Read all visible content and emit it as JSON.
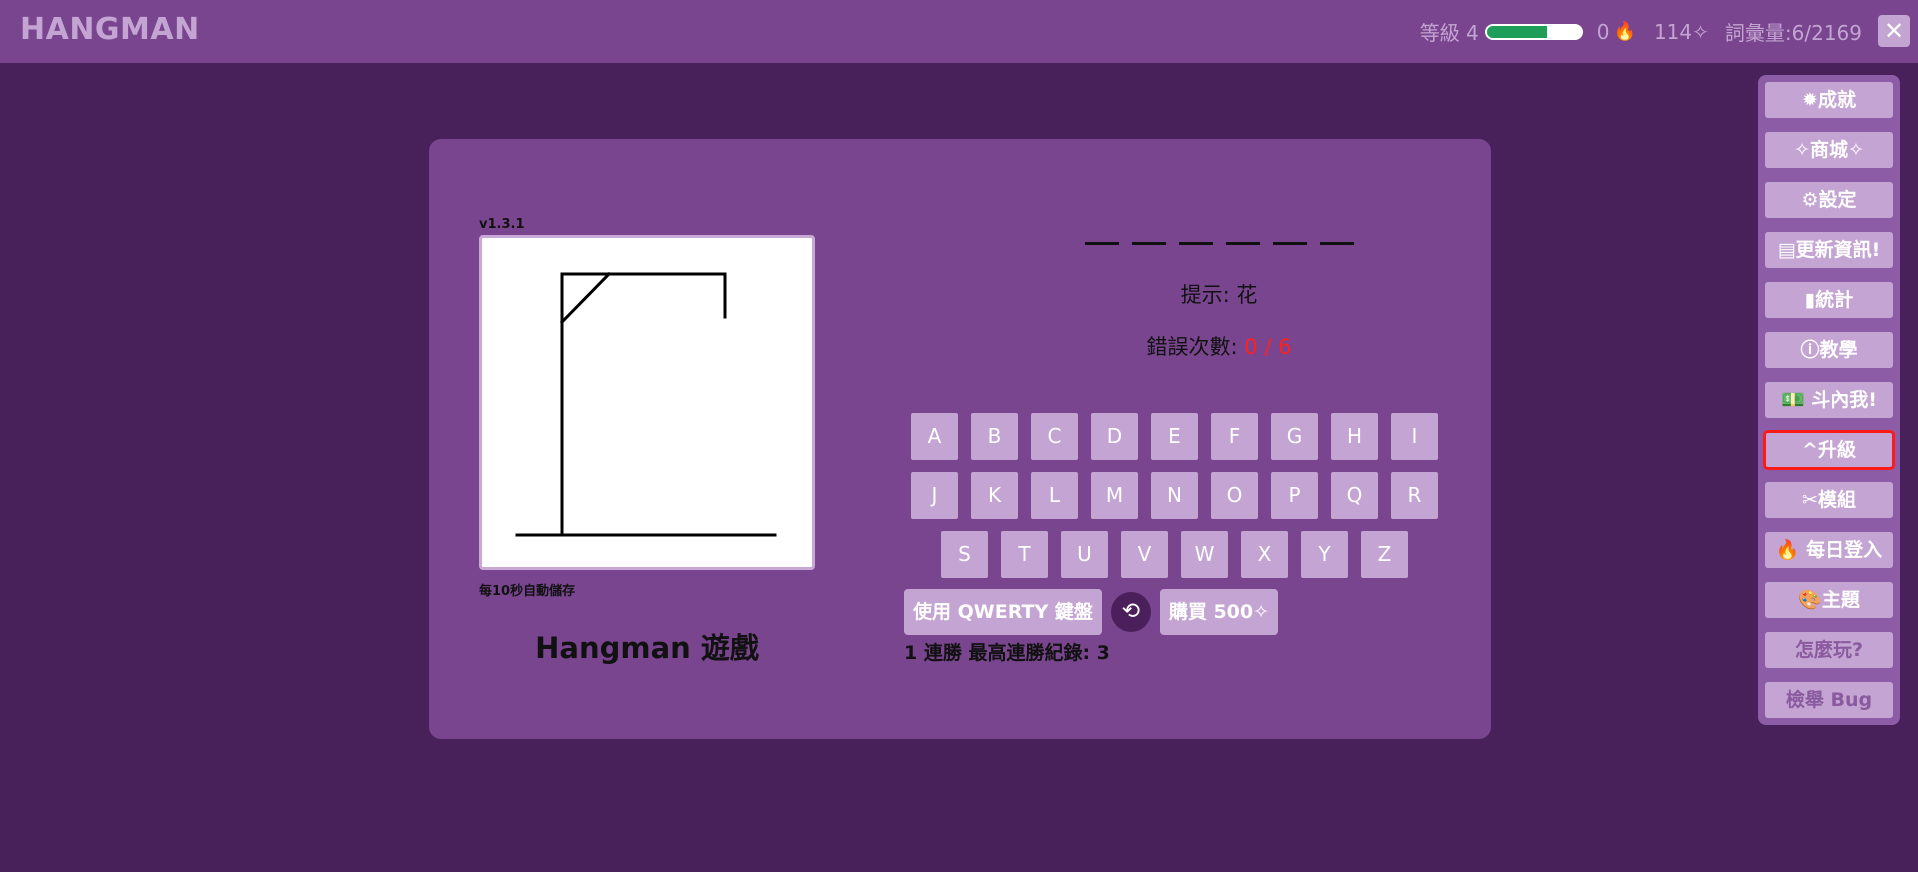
{
  "header": {
    "app_title": "HANGMAN",
    "level_label": "等級 4",
    "xp_progress": 0.64,
    "streak_count": "0",
    "streak_icon": "🔥",
    "coins": "114✧",
    "vocab_progress": "詞彙量:6/2169",
    "close_label": "✕"
  },
  "game": {
    "version": "v1.3.1",
    "autosave_note": "每10秒自動儲存",
    "title": "Hangman 遊戲",
    "word_blank_count": 6,
    "hint": "提示: 花",
    "mistakes_label": "錯誤次數:",
    "mistakes_value": "0 / 6",
    "keyboard_rows": [
      [
        "A",
        "B",
        "C",
        "D",
        "E",
        "F",
        "G",
        "H",
        "I"
      ],
      [
        "J",
        "K",
        "L",
        "M",
        "N",
        "O",
        "P",
        "Q",
        "R"
      ],
      [
        "S",
        "T",
        "U",
        "V",
        "W",
        "X",
        "Y",
        "Z"
      ]
    ],
    "qwerty_button": "使用 QWERTY 鍵盤",
    "refresh_icon": "⟲",
    "buy_button": "購買 500✧",
    "streak_status": "1 連勝 最高連勝紀錄: 3"
  },
  "sidebar": {
    "items": [
      {
        "label": "✹成就",
        "name": "achievements"
      },
      {
        "label": "✧商城✧",
        "name": "shop"
      },
      {
        "label": "⚙設定",
        "name": "settings"
      },
      {
        "label": "▤更新資訊!",
        "name": "updates"
      },
      {
        "label": "▮統計",
        "name": "stats"
      },
      {
        "label": "ⓘ教學",
        "name": "tutorial"
      },
      {
        "label": "💵 斗內我!",
        "name": "donate"
      },
      {
        "label": "^升級",
        "name": "upgrade"
      },
      {
        "label": "✂模組",
        "name": "mods"
      },
      {
        "label": "🔥 每日登入",
        "name": "daily-login"
      },
      {
        "label": "🎨主題",
        "name": "theme"
      },
      {
        "label": "怎麼玩?",
        "name": "how-to-play"
      },
      {
        "label": "檢舉 Bug",
        "name": "report-bug"
      }
    ],
    "highlighted": "upgrade"
  },
  "colors": {
    "background": "#48205a",
    "panel": "#79458f",
    "button": "#c4a4d2",
    "accent_red": "#ff2020",
    "xp_green": "#1f9e5a"
  }
}
